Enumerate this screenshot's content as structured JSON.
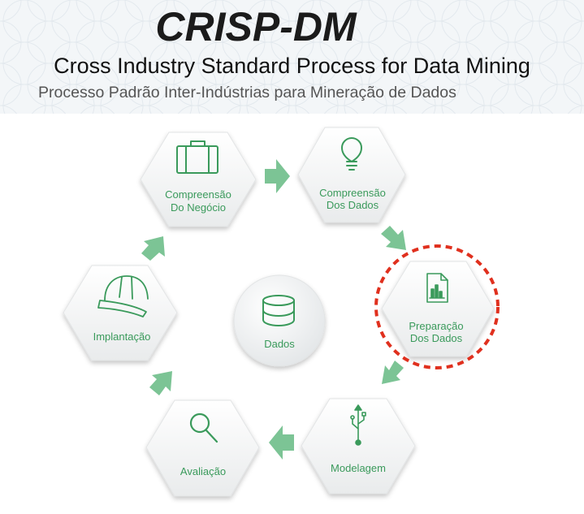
{
  "header": {
    "title": "CRISP-DM",
    "subtitle": "Cross Industry Standard Process for Data Mining",
    "subtitle_pt": "Processo Padrão Inter-Indústrias para Mineração de Dados"
  },
  "diagram": {
    "center_label": "Dados",
    "phases": [
      {
        "line1": "Compreensão",
        "line2": "Do Negócio",
        "icon": "briefcase-icon"
      },
      {
        "line1": "Compreensão",
        "line2": "Dos Dados",
        "icon": "lightbulb-icon"
      },
      {
        "line1": "Preparação",
        "line2": "Dos Dados",
        "icon": "document-chart-icon",
        "highlighted": true
      },
      {
        "line1": "Modelagem",
        "line2": "",
        "icon": "usb-icon"
      },
      {
        "line1": "Avaliação",
        "line2": "",
        "icon": "magnifier-icon"
      },
      {
        "line1": "Implantação",
        "line2": "",
        "icon": "hard-hat-icon"
      }
    ],
    "colors": {
      "accent": "#3a9a5b",
      "arrow": "#7cc495",
      "highlight": "#e0301e"
    }
  }
}
